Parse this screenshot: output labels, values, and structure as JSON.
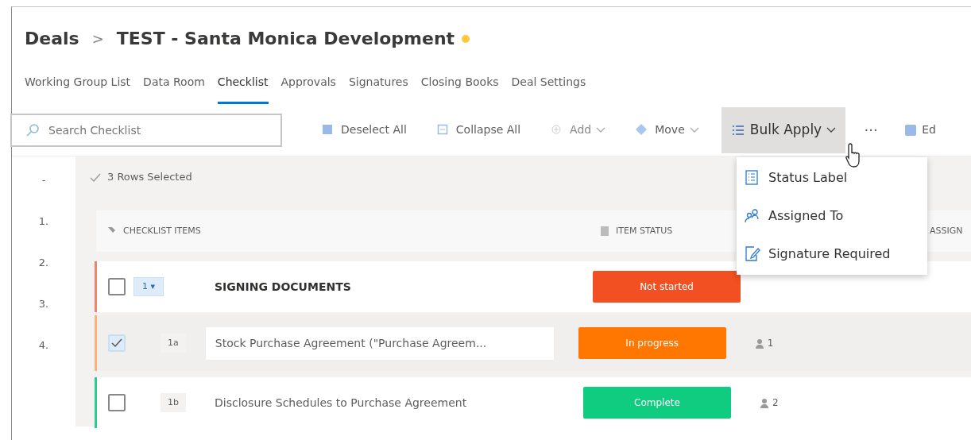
{
  "breadcrumb": {
    "root": "Deals",
    "separator": ">",
    "title": "TEST - Santa Monica Development",
    "favorite": true
  },
  "tabs": [
    {
      "label": "Working Group List",
      "selected": false
    },
    {
      "label": "Data Room",
      "selected": false
    },
    {
      "label": "Checklist",
      "selected": true
    },
    {
      "label": "Approvals",
      "selected": false
    },
    {
      "label": "Signatures",
      "selected": false
    },
    {
      "label": "Closing Books",
      "selected": false
    },
    {
      "label": "Deal Settings",
      "selected": false
    }
  ],
  "toolbar": {
    "search": {
      "placeholder": "Search Checklist"
    },
    "actions": [
      {
        "label": "Deselect All",
        "caret": false,
        "disabled": false,
        "expanded": false
      },
      {
        "label": "Collapse All",
        "caret": false,
        "disabled": false,
        "expanded": false
      },
      {
        "label": "Add",
        "caret": true,
        "disabled": true,
        "expanded": false
      },
      {
        "label": "Move",
        "caret": true,
        "disabled": false,
        "expanded": false
      },
      {
        "label": "Bulk Apply",
        "caret": true,
        "disabled": false,
        "expanded": true
      }
    ],
    "more": "···",
    "cut_action": "Ed"
  },
  "bulk_apply_menu": [
    "Status Label",
    "Assigned To",
    "Signature Required"
  ],
  "row_numbers": [
    "-",
    "1.",
    "2.",
    "3.",
    "4."
  ],
  "selection_summary": "3 Rows Selected",
  "columns": [
    "CHECKLIST ITEMS",
    "ITEM STATUS",
    "ASSIGN"
  ],
  "rows": [
    {
      "kind": "section",
      "checked": false,
      "selected": false,
      "color": "#f4826a",
      "number": "1 ▾",
      "text": "SIGNING DOCUMENTS",
      "status": {
        "label": "Not started",
        "color": "#f25022"
      }
    },
    {
      "kind": "item",
      "checked": true,
      "selected": true,
      "color": "#f7b47a",
      "number": "1a",
      "text": "Stock Purchase Agreement (\"Purchase Agreem...",
      "status": {
        "label": "In progress",
        "color": "#ff7700"
      },
      "assignees": "1"
    },
    {
      "kind": "item",
      "checked": false,
      "selected": false,
      "color": "#25d08c",
      "number": "1b",
      "text": "Disclosure Schedules to Purchase Agreement",
      "status": {
        "label": "Complete",
        "color": "#10cc80"
      },
      "assignees": "2"
    }
  ]
}
